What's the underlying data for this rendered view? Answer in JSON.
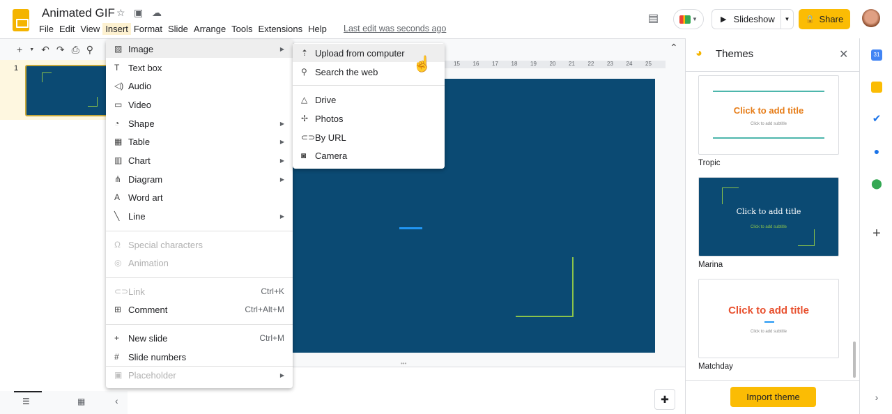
{
  "app": {
    "title": "Animated GIF",
    "last_edit": "Last edit was seconds ago"
  },
  "menubar": [
    "File",
    "Edit",
    "View",
    "Insert",
    "Format",
    "Slide",
    "Arrange",
    "Tools",
    "Extensions",
    "Help"
  ],
  "header": {
    "slideshow": "Slideshow",
    "share": "Share"
  },
  "filmstrip": {
    "slide_number": "1"
  },
  "ruler": [
    "15",
    "16",
    "17",
    "18",
    "19",
    "20",
    "21",
    "22",
    "23",
    "24",
    "25"
  ],
  "insert_menu": [
    {
      "label": "Image",
      "icon": "image-icon",
      "submenu": true
    },
    {
      "label": "Text box",
      "icon": "textbox-icon"
    },
    {
      "label": "Audio",
      "icon": "audio-icon"
    },
    {
      "label": "Video",
      "icon": "video-icon"
    },
    {
      "label": "Shape",
      "icon": "shape-icon",
      "submenu": true
    },
    {
      "label": "Table",
      "icon": "table-icon",
      "submenu": true
    },
    {
      "label": "Chart",
      "icon": "chart-icon",
      "submenu": true
    },
    {
      "label": "Diagram",
      "icon": "diagram-icon",
      "submenu": true
    },
    {
      "label": "Word art",
      "icon": "wordart-icon"
    },
    {
      "label": "Line",
      "icon": "line-icon",
      "submenu": true
    },
    {
      "label": "Special characters",
      "icon": "omega-icon",
      "disabled": true
    },
    {
      "label": "Animation",
      "icon": "animation-icon",
      "disabled": true
    },
    {
      "label": "Link",
      "icon": "link-icon",
      "disabled": true,
      "shortcut": "Ctrl+K"
    },
    {
      "label": "Comment",
      "icon": "comment-icon",
      "shortcut": "Ctrl+Alt+M"
    },
    {
      "label": "New slide",
      "icon": "plus-icon",
      "shortcut": "Ctrl+M"
    },
    {
      "label": "Slide numbers",
      "icon": "hash-icon"
    },
    {
      "label": "Placeholder",
      "icon": "placeholder-icon",
      "disabled": true,
      "submenu": true
    }
  ],
  "image_submenu": [
    {
      "label": "Upload from computer",
      "icon": "upload-icon"
    },
    {
      "label": "Search the web",
      "icon": "search-icon"
    },
    {
      "label": "Drive",
      "icon": "drive-icon"
    },
    {
      "label": "Photos",
      "icon": "photos-icon"
    },
    {
      "label": "By URL",
      "icon": "link-icon"
    },
    {
      "label": "Camera",
      "icon": "camera-icon"
    }
  ],
  "themes": {
    "title": "Themes",
    "items": [
      {
        "name": "Tropic",
        "title": "Click to add title",
        "subtitle": "Click to add subtitle"
      },
      {
        "name": "Marina",
        "title": "Click to add title",
        "subtitle": "Click to add subtitle"
      },
      {
        "name": "Matchday",
        "title": "Click to add title",
        "subtitle": "Click to add subtitle"
      }
    ],
    "import": "Import theme"
  },
  "colors": {
    "accent": "#fbbc04",
    "slide_bg": "#0b4a73",
    "slide_line": "#8bc34a"
  }
}
